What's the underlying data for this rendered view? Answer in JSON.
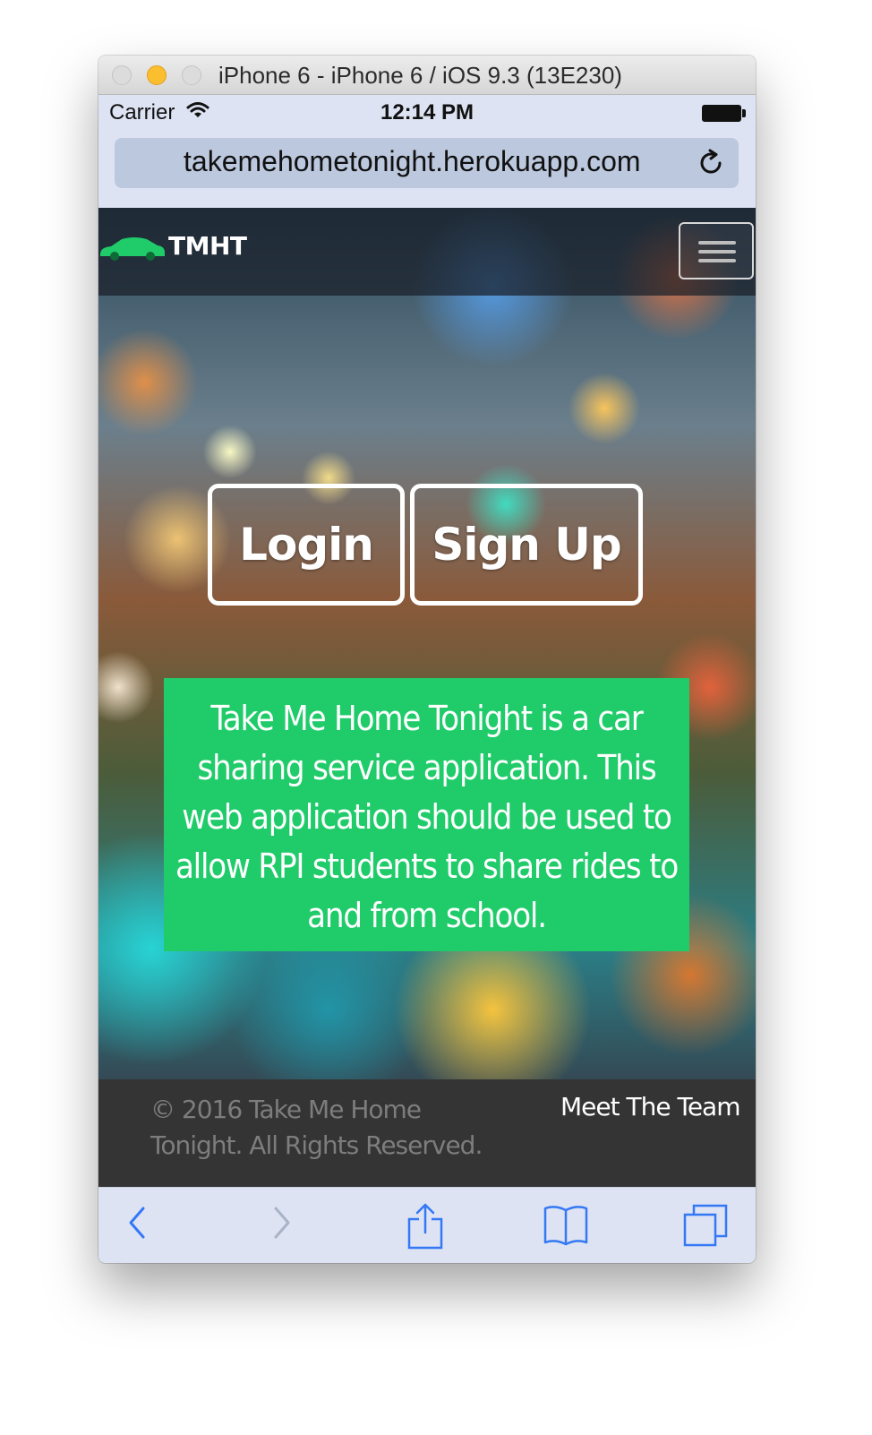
{
  "window": {
    "title": "iPhone 6 - iPhone 6 / iOS 9.3 (13E230)"
  },
  "status_bar": {
    "carrier": "Carrier",
    "time": "12:14 PM"
  },
  "browser": {
    "url": "takemehometonight.herokuapp.com"
  },
  "site": {
    "brand": "TMHT",
    "login_label": "Login",
    "signup_label": "Sign Up",
    "description": "Take Me Home Tonight is a car sharing service application. This web application should be used to allow RPI students to share rides to and from school.",
    "footer": {
      "copyright": "© 2016 Take Me Home Tonight. All Rights Reserved.",
      "meet_team": "Meet The Team"
    }
  },
  "colors": {
    "accent_green": "#20cb6a",
    "footer_bg": "#343434",
    "safari_chrome": "#dde3f2",
    "ios_blue": "#3478f6"
  },
  "icons": [
    "wifi-icon",
    "battery-icon",
    "reload-icon",
    "car-logo-icon",
    "hamburger-icon",
    "back-icon",
    "forward-icon",
    "share-icon",
    "bookmarks-icon",
    "tabs-icon"
  ]
}
